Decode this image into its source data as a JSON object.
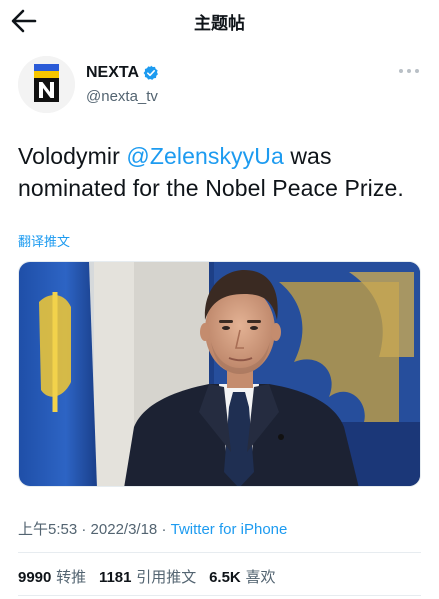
{
  "header": {
    "title": "主题帖",
    "back_icon": "arrow-left-icon"
  },
  "author": {
    "display_name": "NEXTA",
    "handle": "@nexta_tv",
    "verified": true,
    "avatar_letter": "N"
  },
  "tweet": {
    "text_before": "Volodymir ",
    "mention": "@ZelenskyyUa",
    "text_after": " was nominated for the Nobel Peace Prize.",
    "translate_label": "翻译推文"
  },
  "meta": {
    "time": "上午5:53",
    "separator1": " · ",
    "date": "2022/3/18",
    "separator2": " · ",
    "source": "Twitter for iPhone"
  },
  "stats": {
    "retweets_count": "9990",
    "retweets_label": "转推",
    "quotes_count": "1181",
    "quotes_label": "引用推文",
    "likes_count": "6.5K",
    "likes_label": "喜欢"
  },
  "colors": {
    "accent": "#1d9bf0",
    "secondary_text": "#536471",
    "primary_text": "#0f1419",
    "avatar_yellow": "#f7c600",
    "avatar_blue": "#2a5bd7"
  }
}
